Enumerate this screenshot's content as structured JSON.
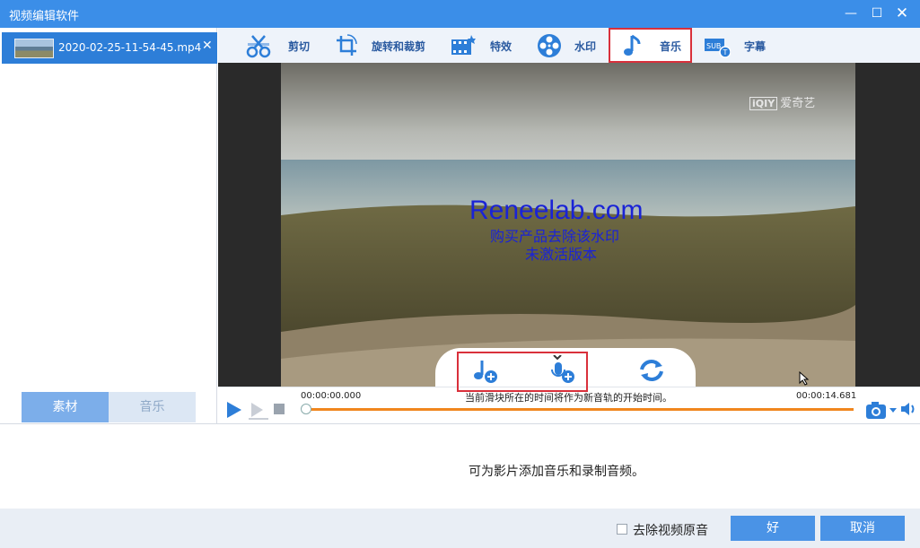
{
  "window": {
    "title": "视频编辑软件",
    "minimize": "—",
    "maximize": "☐",
    "close": "✕"
  },
  "file_list": [
    {
      "name": "2020-02-25-11-54-45.mp4",
      "close": "✕"
    }
  ],
  "left_tabs": [
    {
      "label": "素材",
      "active": true
    },
    {
      "label": "音乐",
      "active": false
    }
  ],
  "toolbar": {
    "tools": [
      {
        "label": "剪切",
        "icon": "scissors-icon"
      },
      {
        "label": "旋转和裁剪",
        "icon": "crop-rotate-icon"
      },
      {
        "label": "特效",
        "icon": "film-effect-icon"
      },
      {
        "label": "水印",
        "icon": "film-reel-icon"
      },
      {
        "label": "音乐",
        "icon": "music-note-icon",
        "active": true
      },
      {
        "label": "字幕",
        "icon": "subtitle-icon"
      }
    ]
  },
  "video": {
    "watermark_line1": "Reneelab.com",
    "watermark_line2": "购买产品去除该水印",
    "watermark_line3": "未激活版本",
    "channel_logo_box": "iQIY",
    "channel_logo_text": "爱奇艺"
  },
  "music_tools": [
    {
      "icon": "add-music-icon"
    },
    {
      "icon": "add-recording-icon"
    },
    {
      "icon": "refresh-icon"
    }
  ],
  "playback": {
    "time_start": "00:00:00.000",
    "time_end": "00:00:14.681",
    "hint": "当前滑块所在的时间将作为新音轨的开始时间。",
    "progress": 0
  },
  "info": {
    "text": "可为影片添加音乐和录制音频。"
  },
  "bottom": {
    "checkbox_label": "去除视频原音",
    "checked": false,
    "ok_label": "好",
    "cancel_label": "取消"
  },
  "colors": {
    "accent": "#3b8ee8",
    "highlight_red": "#d9303b",
    "progress_orange": "#f0861e"
  }
}
